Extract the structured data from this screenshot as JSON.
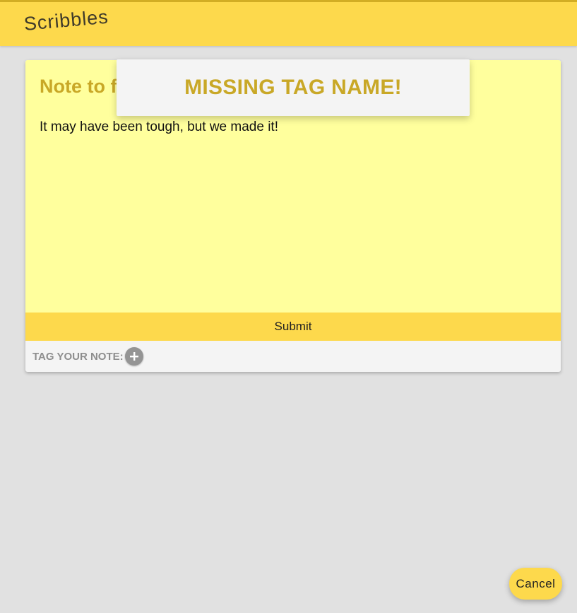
{
  "app": {
    "title": "Scribbles"
  },
  "note": {
    "title": "Note to f",
    "body": "It may have been tough, but we made it!",
    "submit_label": "Submit",
    "tag_label": "TAG YOUR NOTE:",
    "add_tag_icon": "plus-icon"
  },
  "toast": {
    "message": "MISSING TAG NAME!"
  },
  "actions": {
    "cancel_label": "Cancel"
  },
  "colors": {
    "accent": "#fdd94c",
    "note_background": "#ffff9d",
    "title_text": "#c9a827",
    "page_background": "#e1e1e1"
  }
}
